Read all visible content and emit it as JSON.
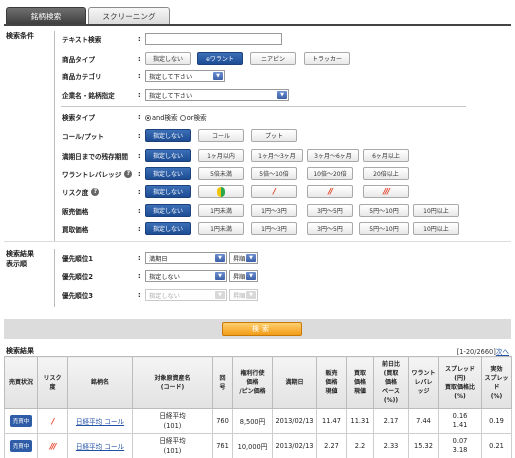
{
  "tabs": [
    {
      "label": "銘柄検索",
      "active": true
    },
    {
      "label": "スクリーニング",
      "active": false
    }
  ],
  "conditions": {
    "section_label": "検索条件",
    "text_search": {
      "label": "テキスト検索",
      "value": ""
    },
    "product_type": {
      "label": "商品タイプ",
      "options": [
        "指定しない",
        "eワラント",
        "ニアピン",
        "トラッカー"
      ],
      "selected": "eワラント"
    },
    "product_category": {
      "label": "商品カテゴリ",
      "value": "指定して下さい"
    },
    "company": {
      "label": "企業名・銘柄指定",
      "value": "指定して下さい"
    },
    "search_type": {
      "label": "検索タイプ",
      "options": [
        "and検索",
        "or検索"
      ],
      "selected": "and検索"
    },
    "call_put": {
      "label": "コール/プット",
      "options": [
        "指定しない",
        "コール",
        "プット"
      ],
      "selected": "指定しない"
    },
    "days_to_expiry": {
      "label": "満期日までの残存期間",
      "options": [
        "指定しない",
        "1ヶ月以内",
        "1ヶ月～3ヶ月",
        "3ヶ月～6ヶ月",
        "6ヶ月以上"
      ],
      "selected": "指定しない"
    },
    "leverage": {
      "label": "ワラントレバレッジ",
      "options": [
        "指定しない",
        "5倍未満",
        "5倍～10倍",
        "10倍～20倍",
        "20倍以上"
      ],
      "selected": "指定しない"
    },
    "risk": {
      "label": "リスク度",
      "options": [
        "指定しない",
        "",
        "/",
        "//",
        "///"
      ],
      "selected": "指定しない"
    },
    "sell_price": {
      "label": "販売価格",
      "options": [
        "指定しない",
        "1円未満",
        "1円～3円",
        "3円～5円",
        "5円～10円",
        "10円以上"
      ],
      "selected": "指定しない"
    },
    "buy_price": {
      "label": "買取価格",
      "options": [
        "指定しない",
        "1円未満",
        "1円～3円",
        "3円～5円",
        "5円～10円",
        "10円以上"
      ],
      "selected": "指定しない"
    }
  },
  "order": {
    "section_label": "検索結果表示順",
    "section_label_line1": "検索結果",
    "section_label_line2": "表示順",
    "rows": [
      {
        "label": "優先順位1",
        "value": "満期日",
        "dir": "昇順",
        "disabled": false
      },
      {
        "label": "優先順位2",
        "value": "指定しない",
        "dir": "昇順",
        "disabled": false
      },
      {
        "label": "優先順位3",
        "value": "指定しない",
        "dir": "昇順",
        "disabled": true
      }
    ]
  },
  "search_button": "検索",
  "results": {
    "title": "検索結果",
    "range": "[1-20/2660]",
    "next": "次へ",
    "headers": [
      "売買状況",
      "リスク度",
      "銘柄名",
      "対象原資産名(コード)",
      "回号",
      "権利行使価格/ピン価格",
      "満期日",
      "販売価格現値",
      "買取価格現値",
      "前日比(買取価格ベース)(%)",
      "ワラントレバレッジ",
      "スプレッド(円)買取価格比(%)",
      "実効スプレッド(%)"
    ],
    "header_lines": [
      [
        "売買状況"
      ],
      [
        "リスク",
        "度"
      ],
      [
        "銘柄名"
      ],
      [
        "対象原資産名",
        "(コード)"
      ],
      [
        "回",
        "号"
      ],
      [
        "権利行使",
        "価格",
        "/ピン価格"
      ],
      [
        "満期日"
      ],
      [
        "販売",
        "価格",
        "現値"
      ],
      [
        "買取",
        "価格",
        "現値"
      ],
      [
        "前日比",
        "(買取",
        "価格",
        "ベース",
        "(%))"
      ],
      [
        "ワラント",
        "レバレ",
        "ッジ"
      ],
      [
        "スプレッド",
        "(円)",
        "買取価格比",
        "(%)"
      ],
      [
        "実効",
        "スプレッド",
        "(%)"
      ]
    ],
    "rows": [
      {
        "status": "売買中",
        "risk": "/",
        "name": "日経平均 コール",
        "underlying": "日経平均",
        "code": "(101)",
        "series": "760",
        "strike": "8,500円",
        "expiry": "2013/02/13",
        "sell": "11.47",
        "buy": "11.31",
        "change": "2.17",
        "leverage": "7.44",
        "spread_yen": "0.16",
        "spread_pct": "1.41",
        "effective": "0.19"
      },
      {
        "status": "売買中",
        "risk": "///",
        "name": "日経平均 コール",
        "underlying": "日経平均",
        "code": "(101)",
        "series": "761",
        "strike": "10,000円",
        "expiry": "2013/02/13",
        "sell": "2.27",
        "buy": "2.2",
        "change": "2.33",
        "leverage": "15.32",
        "spread_yen": "0.07",
        "spread_pct": "3.18",
        "effective": "0.21"
      }
    ]
  },
  "colors": {
    "selected": "#1d4c93",
    "accent": "#f29c16",
    "link": "#2251a3",
    "risk": "#e23a1e"
  }
}
